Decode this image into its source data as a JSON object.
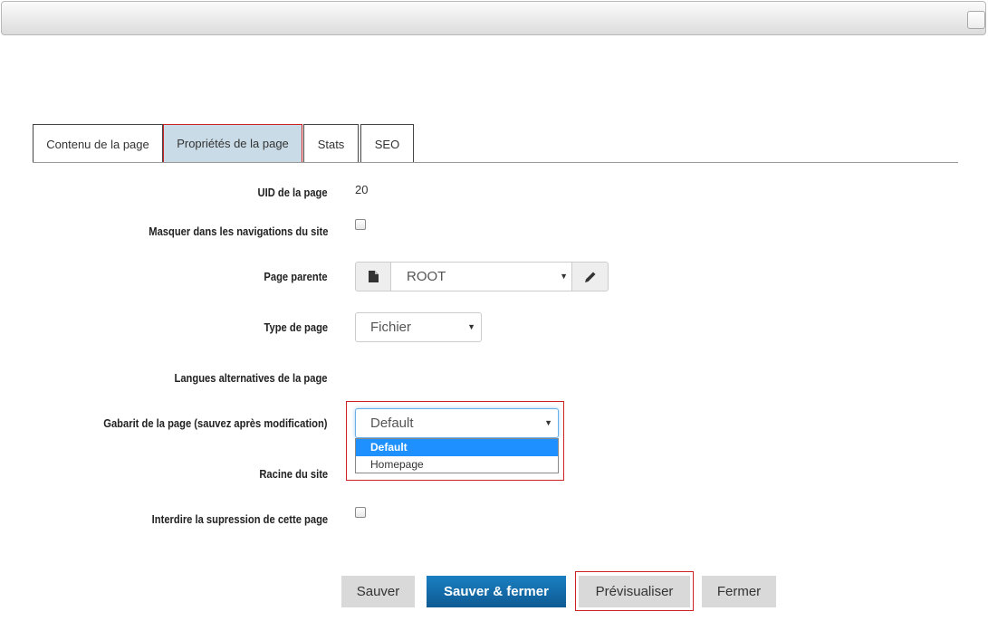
{
  "tabs": [
    {
      "label": "Contenu de la page"
    },
    {
      "label": "Propriétés de la page"
    },
    {
      "label": "Stats"
    },
    {
      "label": "SEO"
    }
  ],
  "form": {
    "uid_label": "UID de la page",
    "uid_value": "20",
    "hide_nav_label": "Masquer dans les navigations du site",
    "parent_label": "Page parente",
    "parent_value": "ROOT",
    "type_label": "Type de page",
    "type_value": "Fichier",
    "alt_lang_label": "Langues alternatives de la page",
    "template_label": "Gabarit de la page (sauvez après modification)",
    "template_value": "Default",
    "template_options": [
      "Default",
      "Homepage"
    ],
    "root_label": "Racine du site",
    "no_delete_label": "Interdire la supression de cette page"
  },
  "buttons": {
    "save": "Sauver",
    "save_close": "Sauver & fermer",
    "preview": "Prévisualiser",
    "close": "Fermer"
  },
  "icons": {
    "file": "file-icon",
    "edit": "pencil-icon",
    "caret": "caret-down-icon"
  }
}
